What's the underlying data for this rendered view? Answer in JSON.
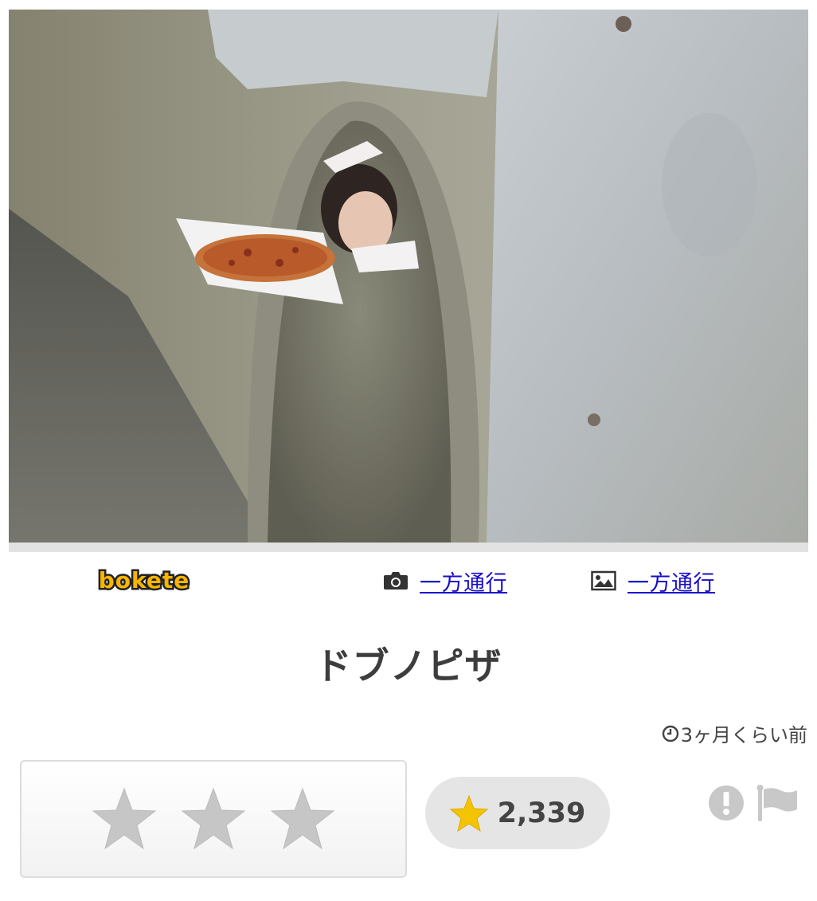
{
  "post": {
    "title": "ドブノピザ",
    "time": "3ヶ月くらい前",
    "score": "2,339"
  },
  "credits": {
    "logo_text": "bokete",
    "photographer": "一方通行",
    "image_author": "一方通行"
  },
  "rating": {
    "stars": 3
  },
  "icons": {
    "camera": "camera-icon",
    "image": "image-icon",
    "clock": "clock-icon",
    "star_filled": "star-icon",
    "report": "exclamation-icon",
    "flag": "flag-icon"
  },
  "colors": {
    "link": "#1a0dcc",
    "star_gold": "#f5c400",
    "star_gray": "#c6c6c6",
    "logo_yellow": "#f7b500"
  }
}
